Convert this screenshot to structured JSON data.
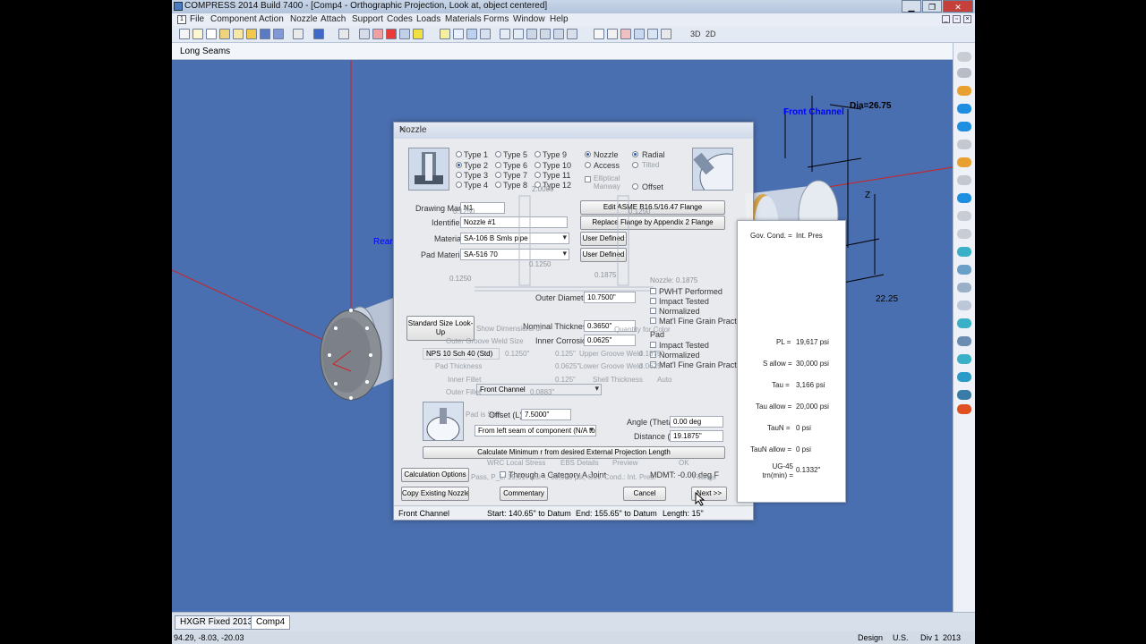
{
  "window": {
    "title": "COMPRESS 2014 Build 7400 - [Comp4 - Orthographic Projection, Look at, object centered]"
  },
  "menu": [
    "File",
    "Component",
    "Action",
    "Nozzle",
    "Attach",
    "Support",
    "Codes",
    "Loads",
    "Materials",
    "Forms",
    "Window",
    "Help"
  ],
  "toolbar": {
    "label_3d": "3D",
    "label_2d": "2D"
  },
  "subbar": {
    "label": "Long Seams"
  },
  "viewport": {
    "front_channel": "Front Channel",
    "dia": "Dia=26.75",
    "z_label": "Z",
    "dim_2225": "22.25",
    "rear": "Rear",
    "accent_color": "#0000ff"
  },
  "dialog": {
    "title": "Nozzle",
    "close": "×",
    "types_col1": [
      "Type 1",
      "Type 2",
      "Type 3",
      "Type 4"
    ],
    "types_col2": [
      "Type 5",
      "Type 6",
      "Type 7",
      "Type 8"
    ],
    "types_col3": [
      "Type 9",
      "Type 10",
      "Type 11",
      "Type 12"
    ],
    "kind": [
      "Nozzle",
      "Access",
      "Elliptical Manway"
    ],
    "orientation": [
      "Radial",
      "Tilted",
      "Offset"
    ],
    "drawing_mark_label": "Drawing Mark",
    "drawing_mark_value": "N1",
    "identifier_label": "Identifier",
    "identifier_value": "Nozzle #1",
    "material_label": "Material",
    "material_value": "SA-106 B Smls pipe",
    "pad_material_label": "Pad Material",
    "pad_material_value": "SA-516 70",
    "edit_flange": "Edit ASME B16.5/16.47 Flange",
    "replace_flange": "Replace Flange by Appendix 2 Flange",
    "user_defined_1": "User Defined",
    "user_defined_2": "User Defined",
    "dims": {
      "d1": "0.1250",
      "d2": "0.1250",
      "d3": "0.1250",
      "d4": "0.1875",
      "d5": "2.0000",
      "d6": "0.1250",
      "nozzle_dim": "Nozzle: 0.1875"
    },
    "outer_diameter_label": "Outer Diameter",
    "outer_diameter_value": "10.7500\"",
    "pwht": "PWHT Performed",
    "impact_tested": "Impact Tested",
    "normalized": "Normalized",
    "fine_grain": "Mat'l Fine Grain Practice",
    "pad_label": "Pad",
    "pad_impact": "Impact Tested",
    "pad_normalized": "Normalized",
    "pad_fine_grain": "Mat'l Fine Grain Practice",
    "standard_size_btn": "Standard Size Look-Up",
    "nominal_thk_label": "Nominal Thickness",
    "nominal_thk_value": "0.3650\"",
    "inner_corrosion_label": "Inner Corrosion",
    "inner_corrosion_value": "0.0625\"",
    "nps_value": "NPS 10 Sch 40 (Std)",
    "attach_to_value": "Front Channel",
    "offset_label": "Offset (L)",
    "offset_value": "7.5000\"",
    "from_value": "From left seam of component (N/A to",
    "angle_label": "Angle (Theta)",
    "angle_value": "0.00 deg",
    "distance_label": "Distance (r)",
    "distance_value": "19.1875\"",
    "calc_min_btn": "Calculate Minimum r from desired External Projection Length",
    "ghost_show_dims": "Show Dimensions of",
    "ghost_upper_groove": "Upper Groove Weld",
    "ghost_lower_groove": "Lower Groove Weld",
    "ghost_outer_groove": "Outer Groove Weld Size",
    "ghost_pad_thk": "Pad Thickness",
    "ghost_inner_fillet": "Inner Fillet",
    "ghost_outer_fillet": "Outer Fillet",
    "ghost_shell_thk": "Shell Thickness",
    "ghost_auto": "Auto",
    "ghost_quantity": "Quantity for Color",
    "ghost_pad_is": "Pad is Split",
    "ghost_val1": "0.1250\"",
    "ghost_val2": "0.125\"",
    "ghost_val3": "0.0625\"",
    "ghost_val4": "0.125\"",
    "ghost_val5": "0.0883\"",
    "ghost_val6": "0.1875\"",
    "ghost_val7": "0.0625\"",
    "ghost_local_stress": "WRC Local Stress",
    "ghost_ebs": "EBS Details",
    "ghost_preview": "Preview",
    "ghost_ok": "OK",
    "ghost_pass_line": "Pass, P_L: 19,617 psi ... 30,000 psi, Gov. Cond.: Int. Pres.",
    "calc_options_btn": "Calculation Options",
    "through_cat_a": "Through a Category A Joint",
    "mdmt": "MDMT: -0.00 deg F",
    "fittings": "Fittings",
    "copy_existing_btn": "Copy Existing Nozzle",
    "commentary_btn": "Commentary",
    "cancel_btn": "Cancel",
    "next_btn": "Next >>",
    "status_component": "Front Channel",
    "status_start": "Start: 140.65\" to Datum",
    "status_end": "End: 155.65\" to Datum",
    "status_length": "Length: 15\""
  },
  "results": {
    "gov_cond_label": "Gov. Cond. =",
    "gov_cond_value": "Int. Pres",
    "pl_label": "PL =",
    "pl_value": "19,617 psi",
    "sallow_label": "S allow =",
    "sallow_value": "30,000 psi",
    "tau_label": "Tau =",
    "tau_value": "3,166 psi",
    "tauallow_label": "Tau allow =",
    "tauallow_value": "20,000 psi",
    "taun_label": "TauN =",
    "taun_value": "0 psi",
    "taunallow_label": "TauN allow =",
    "taunallow_value": "0 psi",
    "ug45_label": "UG-45 trn(min) =",
    "ug45_value": "0.1332\""
  },
  "tabs": [
    "HXGR Fixed 2013",
    "Comp4"
  ],
  "statusbar": {
    "coords": "94.29, -8.03, -20.03",
    "mode": "Design",
    "units": "U.S.",
    "division": "Div 1",
    "year": "2013"
  }
}
